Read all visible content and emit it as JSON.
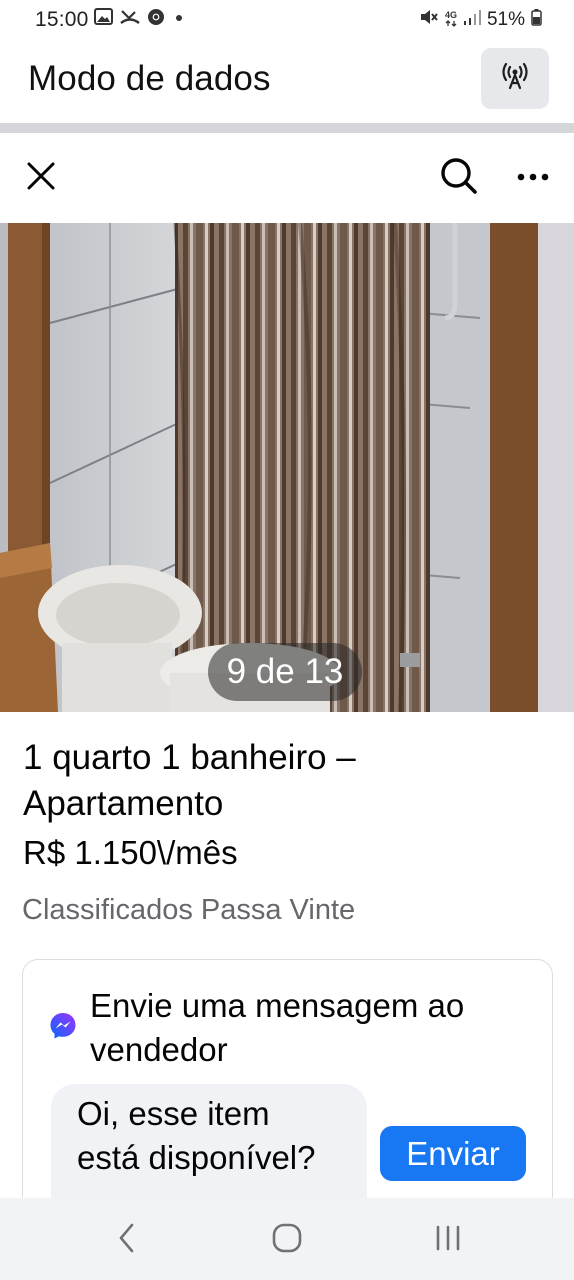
{
  "status_bar": {
    "time": "15:00",
    "network": "4G",
    "battery": "51%",
    "left_icons": [
      "gallery-icon",
      "missed-call-icon",
      "chrome-icon",
      "dot-icon"
    ],
    "right_icons": [
      "mute-icon",
      "network-4g-icon",
      "signal-icon",
      "battery-icon"
    ]
  },
  "data_mode": {
    "title": "Modo de dados",
    "button_icon": "antenna-icon"
  },
  "toolbar": {
    "close_icon": "close-icon",
    "search_icon": "search-icon",
    "more_icon": "more-icon"
  },
  "photo": {
    "counter": "9 de 13"
  },
  "listing": {
    "title": "1 quarto 1 banheiro – Apartamento",
    "price": "R$ 1.150\\/mês",
    "seller": "Classificados Passa Vinte"
  },
  "message": {
    "icon": "messenger-icon",
    "heading": "Envie uma mensagem ao vendedor",
    "input_value": "Oi, esse item está disponível?",
    "send_label": "Enviar"
  },
  "nav_bar": {
    "icons": [
      "back-icon",
      "home-icon",
      "recents-icon"
    ]
  },
  "colors": {
    "accent": "#1877f2",
    "secondary_text": "#65676b",
    "input_bg": "#f0f2f5",
    "divider": "#d4d6d9"
  }
}
